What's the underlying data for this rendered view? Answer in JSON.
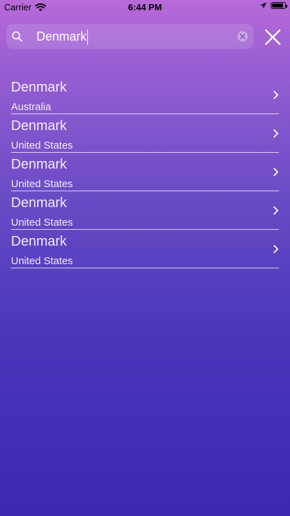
{
  "status_bar": {
    "carrier": "Carrier",
    "time": "6:44 PM",
    "battery_level": 0.9,
    "icons": [
      "wifi-icon",
      "location-arrow-icon",
      "battery-icon"
    ]
  },
  "search": {
    "value": "Denmark",
    "icons": [
      "search-icon",
      "clear-icon"
    ]
  },
  "close_icon": "close-icon",
  "results": [
    {
      "title": "Denmark",
      "subtitle": "Australia"
    },
    {
      "title": "Denmark",
      "subtitle": "United States"
    },
    {
      "title": "Denmark",
      "subtitle": "United States"
    },
    {
      "title": "Denmark",
      "subtitle": "United States"
    },
    {
      "title": "Denmark",
      "subtitle": "United States"
    }
  ],
  "colors": {
    "gradient_top": "#b86ad8",
    "gradient_bottom": "#3a2ab0",
    "text": "#ffffff"
  }
}
